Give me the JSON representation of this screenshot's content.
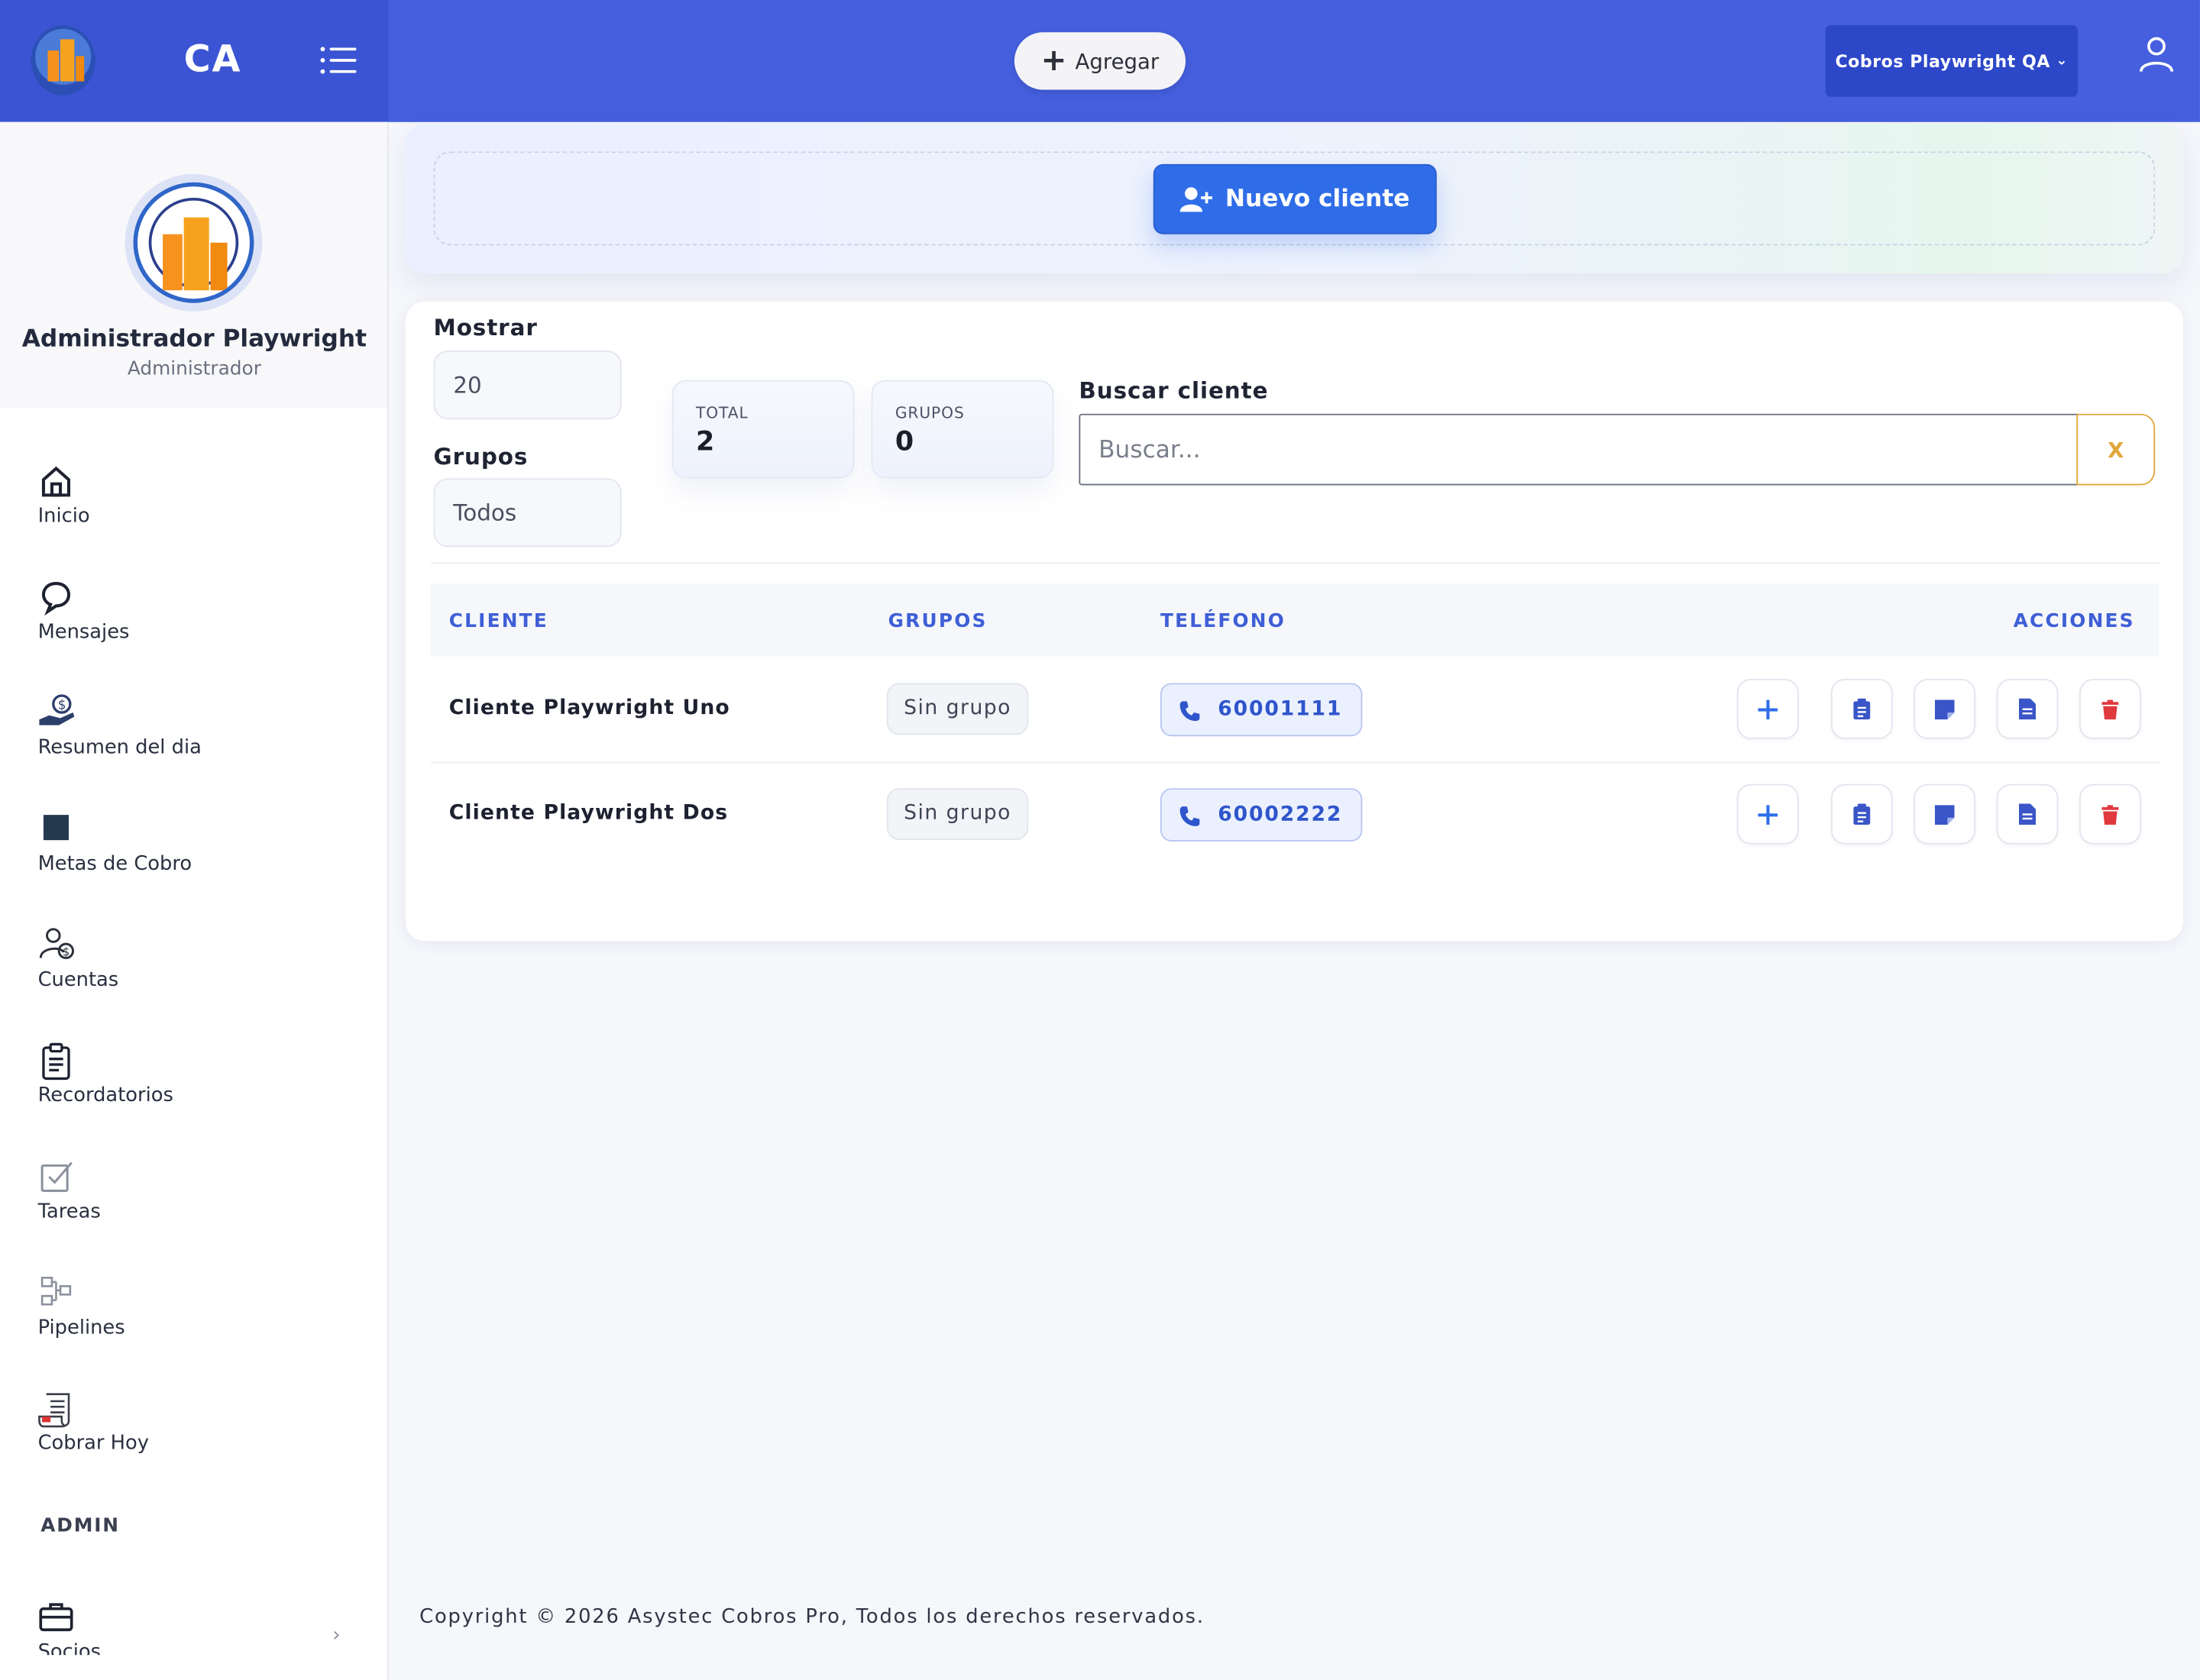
{
  "header": {
    "brand_abbr": "CA",
    "add_label": "Agregar",
    "company": "Cobros Playwright QA"
  },
  "sidebar": {
    "user_name": "Administrador Playwright",
    "user_role": "Administrador",
    "items": [
      {
        "label": "Inicio",
        "icon": "home-icon"
      },
      {
        "label": "Mensajes",
        "icon": "chat-bubble-icon"
      },
      {
        "label": "Resumen del dia",
        "icon": "hand-coin-icon"
      },
      {
        "label": "Metas de Cobro",
        "icon": "square-icon"
      },
      {
        "label": "Cuentas",
        "icon": "user-coin-icon"
      },
      {
        "label": "Recordatorios",
        "icon": "clipboard-list-icon"
      },
      {
        "label": "Tareas",
        "icon": "checkbox-icon"
      },
      {
        "label": "Pipelines",
        "icon": "pipeline-icon"
      },
      {
        "label": "Cobrar Hoy",
        "icon": "receipt-icon"
      }
    ],
    "section_admin": "ADMIN",
    "admin_items": [
      {
        "label": "Socios",
        "icon": "briefcase-icon"
      }
    ]
  },
  "hero": {
    "new_client_label": "Nuevo cliente"
  },
  "filters": {
    "show_label": "Mostrar",
    "show_value": "20",
    "groups_label": "Grupos",
    "groups_value": "Todos",
    "search_label": "Buscar cliente",
    "search_placeholder": "Buscar...",
    "clear_label": "X"
  },
  "stats": {
    "total_label": "TOTAL",
    "total_value": "2",
    "groups_label": "GRUPOS",
    "groups_value": "0"
  },
  "table": {
    "headers": [
      "CLIENTE",
      "GRUPOS",
      "TELÉFONO",
      "ACCIONES"
    ],
    "rows": [
      {
        "cliente": "Cliente Playwright Uno",
        "grupo": "Sin grupo",
        "telefono": "60001111"
      },
      {
        "cliente": "Cliente Playwright Dos",
        "grupo": "Sin grupo",
        "telefono": "60002222"
      }
    ],
    "action_icons": [
      "plus-icon",
      "clipboard-icon",
      "note-icon",
      "document-icon",
      "trash-icon"
    ]
  },
  "footer": {
    "copyright": "Copyright © 2026 Asystec Cobros Pro, Todos los derechos reservados."
  },
  "colors": {
    "topbar": "#455fdf",
    "brand": "#3b54d4",
    "accent": "#2f6de8",
    "danger": "#e0393e",
    "warning": "#e0a63a"
  }
}
